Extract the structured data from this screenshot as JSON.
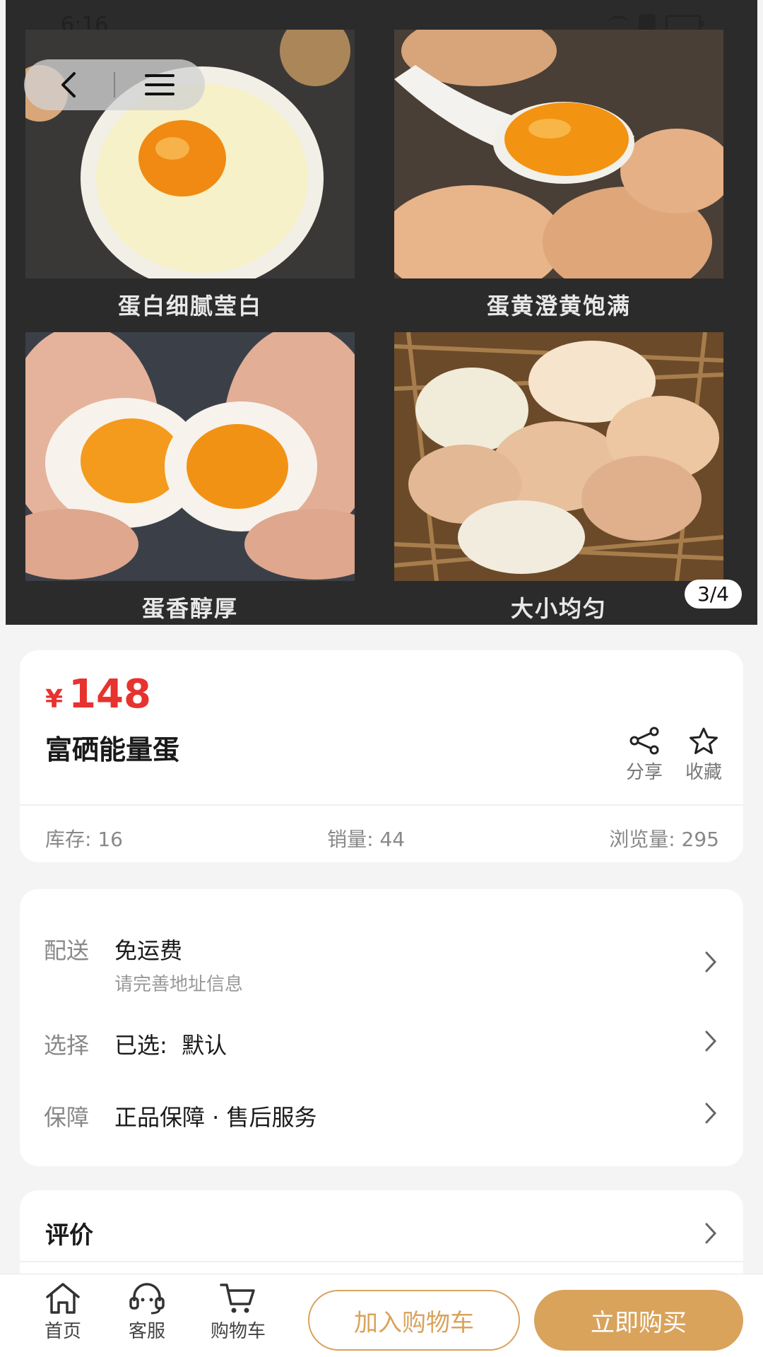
{
  "status_bar": {
    "time": "6:16"
  },
  "hero": {
    "page_indicator": "3/4",
    "captions": [
      "蛋白细腻莹白",
      "蛋黄澄黄饱满",
      "蛋香醇厚",
      "大小均匀"
    ]
  },
  "product": {
    "currency_symbol": "¥",
    "price": "148",
    "title": "富硒能量蛋",
    "share_label": "分享",
    "favorite_label": "收藏",
    "stock": "库存: 16",
    "sales": "销量: 44",
    "views": "浏览量: 295"
  },
  "info": {
    "delivery": {
      "key": "配送",
      "value": "免运费",
      "sub": "请完善地址信息"
    },
    "selection": {
      "key": "选择",
      "value": "已选:  默认"
    },
    "guarantee": {
      "key": "保障",
      "value": "正品保障 · 售后服务"
    }
  },
  "reviews": {
    "title": "评价"
  },
  "bottom_bar": {
    "home_label": "首页",
    "service_label": "客服",
    "cart_label": "购物车",
    "add_to_cart": "加入购物车",
    "buy_now": "立即购买"
  },
  "colors": {
    "price_red": "#e8322e",
    "accent_gold": "#d9a35c",
    "hero_bg": "#2b2b2b"
  }
}
